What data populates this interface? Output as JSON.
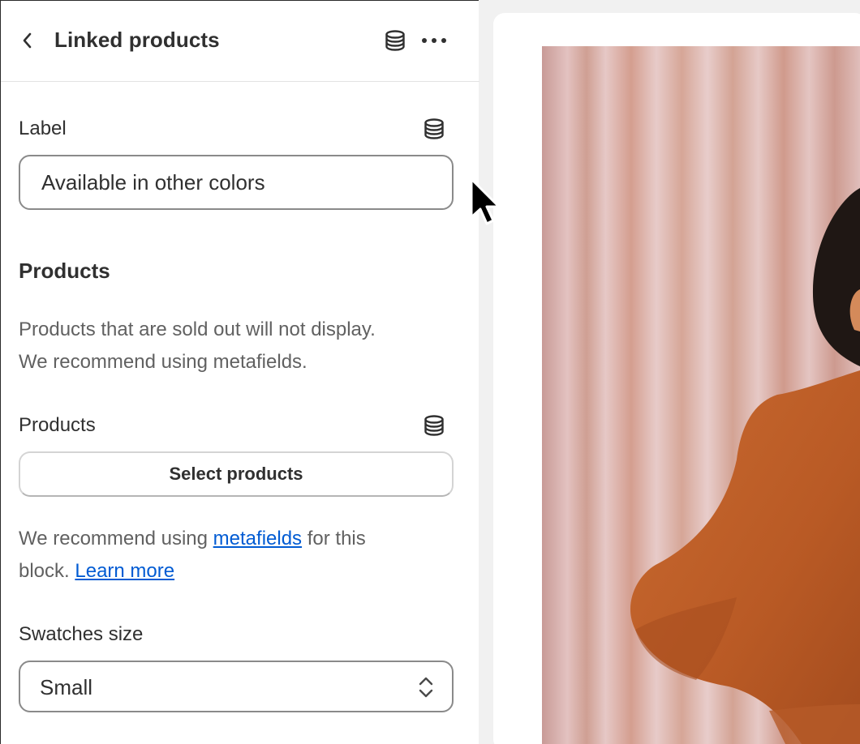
{
  "header": {
    "title": "Linked products",
    "back_icon": "chevron-left-icon",
    "dynamic_source_icon": "database-icon",
    "more_icon": "more-horizontal-icon"
  },
  "label_field": {
    "label": "Label",
    "value": "Available in other colors",
    "icon": "database-icon"
  },
  "products_section": {
    "heading": "Products",
    "help_line_1": "Products that are sold out will not display.",
    "help_line_2": "We recommend using metafields."
  },
  "products_field": {
    "label": "Products",
    "icon": "database-icon",
    "button_label": "Select products",
    "recommend_prefix": "We recommend using ",
    "recommend_link": "metafields",
    "recommend_suffix": " for this",
    "recommend_line2_prefix": "block. ",
    "learn_more_link": "Learn more"
  },
  "swatches_field": {
    "label": "Swatches size",
    "selected_value": "Small",
    "icon": "select-chevrons-icon"
  },
  "colors": {
    "link": "#005bd3",
    "text": "#303030",
    "muted_text": "#616161",
    "sweater": "#c8662c",
    "curtain": "#d7aeae"
  }
}
